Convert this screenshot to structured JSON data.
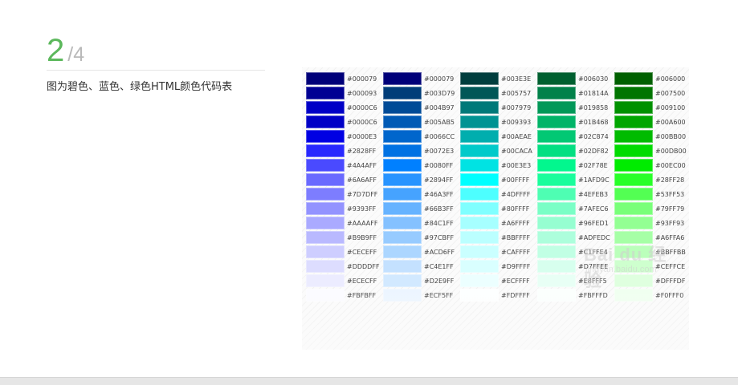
{
  "step": {
    "current": "2",
    "total": "/4"
  },
  "caption": "图为碧色、蓝色、绿色HTML颜色代码表",
  "watermark": {
    "brand": "Bai du 经验",
    "url": "jingyan.baidu.com"
  },
  "colors": {
    "accent": "#5cb85c",
    "muted": "#b9b9b9",
    "caption_text": "#333333",
    "bottom_bar": "#e6e6e6"
  },
  "palette": {
    "columns": [
      {
        "rows": [
          {
            "hex": "#000079"
          },
          {
            "hex": "#000093"
          },
          {
            "hex": "#0000C6"
          },
          {
            "hex": "#0000C6"
          },
          {
            "hex": "#0000E3"
          },
          {
            "hex": "#2828FF"
          },
          {
            "hex": "#4A4AFF"
          },
          {
            "hex": "#6A6AFF"
          },
          {
            "hex": "#7D7DFF"
          },
          {
            "hex": "#9393FF"
          },
          {
            "hex": "#AAAAFF"
          },
          {
            "hex": "#B9B9FF"
          },
          {
            "hex": "#CECEFF"
          },
          {
            "hex": "#DDDDFF"
          },
          {
            "hex": "#ECECFF"
          },
          {
            "hex": "#FBFBFF"
          }
        ]
      },
      {
        "rows": [
          {
            "hex": "#000079"
          },
          {
            "hex": "#003D79"
          },
          {
            "hex": "#004B97"
          },
          {
            "hex": "#005AB5"
          },
          {
            "hex": "#0066CC"
          },
          {
            "hex": "#0072E3"
          },
          {
            "hex": "#0080FF"
          },
          {
            "hex": "#2894FF"
          },
          {
            "hex": "#46A3FF"
          },
          {
            "hex": "#66B3FF"
          },
          {
            "hex": "#84C1FF"
          },
          {
            "hex": "#97CBFF"
          },
          {
            "hex": "#ACD6FF"
          },
          {
            "hex": "#C4E1FF"
          },
          {
            "hex": "#D2E9FF"
          },
          {
            "hex": "#ECF5FF"
          }
        ]
      },
      {
        "rows": [
          {
            "hex": "#003E3E"
          },
          {
            "hex": "#005757"
          },
          {
            "hex": "#007979"
          },
          {
            "hex": "#009393"
          },
          {
            "hex": "#00AEAE"
          },
          {
            "hex": "#00CACA"
          },
          {
            "hex": "#00E3E3"
          },
          {
            "hex": "#00FFFF"
          },
          {
            "hex": "#4DFFFF"
          },
          {
            "hex": "#80FFFF"
          },
          {
            "hex": "#A6FFFF"
          },
          {
            "hex": "#BBFFFF"
          },
          {
            "hex": "#CAFFFF"
          },
          {
            "hex": "#D9FFFF"
          },
          {
            "hex": "#ECFFFF"
          },
          {
            "hex": "#FDFFFF"
          }
        ]
      },
      {
        "rows": [
          {
            "hex": "#006030"
          },
          {
            "hex": "#01814A"
          },
          {
            "hex": "#019858"
          },
          {
            "hex": "#01B468"
          },
          {
            "hex": "#02C874"
          },
          {
            "hex": "#02DF82"
          },
          {
            "hex": "#02F78E"
          },
          {
            "hex": "#1AFD9C"
          },
          {
            "hex": "#4EFEB3"
          },
          {
            "hex": "#7AFEC6"
          },
          {
            "hex": "#96FED1"
          },
          {
            "hex": "#ADFEDC"
          },
          {
            "hex": "#C1FFE4"
          },
          {
            "hex": "#D7FFEE"
          },
          {
            "hex": "#E8FFF5"
          },
          {
            "hex": "#FBFFFD"
          }
        ]
      },
      {
        "rows": [
          {
            "hex": "#006000"
          },
          {
            "hex": "#007500"
          },
          {
            "hex": "#009100"
          },
          {
            "hex": "#00A600"
          },
          {
            "hex": "#00BB00"
          },
          {
            "hex": "#00DB00"
          },
          {
            "hex": "#00EC00"
          },
          {
            "hex": "#28FF28"
          },
          {
            "hex": "#53FF53"
          },
          {
            "hex": "#79FF79"
          },
          {
            "hex": "#93FF93"
          },
          {
            "hex": "#A6FFA6"
          },
          {
            "hex": "#BBFFBB"
          },
          {
            "hex": "#CEFFCE"
          },
          {
            "hex": "#DFFFDF"
          },
          {
            "hex": "#F0FFF0"
          }
        ]
      }
    ]
  }
}
